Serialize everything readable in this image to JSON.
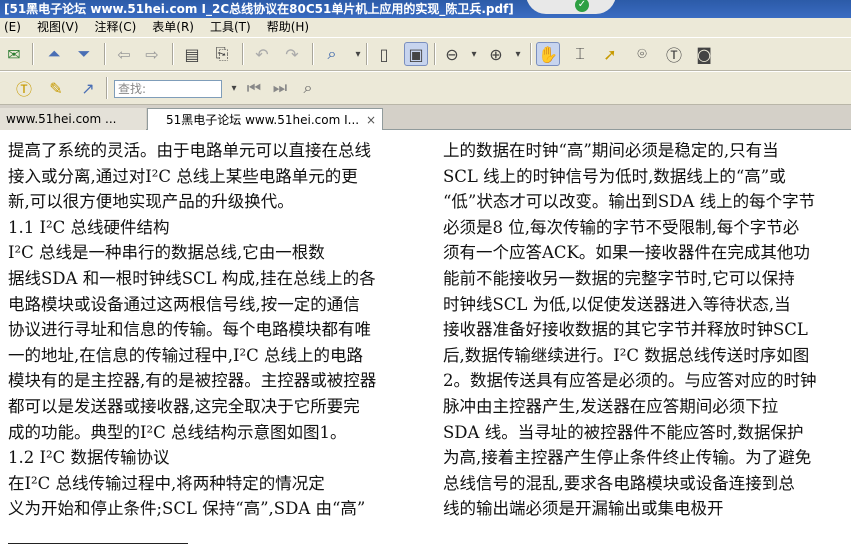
{
  "window": {
    "title": "[51黑电子论坛 www.51hei.com I_2C总线协议在80C51单片机上应用的实现_陈卫兵.pdf]"
  },
  "menu": [
    "(E)",
    "视图(V)",
    "注释(C)",
    "表单(R)",
    "工具(T)",
    "帮助(H)"
  ],
  "toolbar": {
    "find_placeholder": "查找:"
  },
  "tabs": [
    {
      "label": "www.51hei.com ..."
    },
    {
      "label": "51黑电子论坛 www.51hei.com I..."
    }
  ],
  "tab_close": "×",
  "document": {
    "left_lines": [
      "提高了系统的灵活。由于电路单元可以直接在总线",
      "接入或分离,通过对I²C 总线上某些电路单元的更",
      "新,可以很方便地实现产品的升级换代。",
      "1.1   I²C 总线硬件结构",
      "      I²C 总线是一种串行的数据总线,它由一根数",
      "据线SDA 和一根时钟线SCL 构成,挂在总线上的各",
      "电路模块或设备通过这两根信号线,按一定的通信",
      "协议进行寻址和信息的传输。每个电路模块都有唯",
      "一的地址,在信息的传输过程中,I²C 总线上的电路",
      "模块有的是主控器,有的是被控器。主控器或被控器",
      "都可以是发送器或接收器,这完全取决于它所要完",
      "成的功能。典型的I²C 总线结构示意图如图1。",
      "1.2   I²C 数据传输协议",
      "      在I²C 总线传输过程中,将两种特定的情况定",
      "义为开始和停止条件;SCL 保持“高”,SDA 由“高”"
    ],
    "right_lines": [
      "上的数据在时钟“高”期间必须是稳定的,只有当",
      "SCL 线上的时钟信号为低时,数据线上的“高”或",
      "“低”状态才可以改变。输出到SDA 线上的每个字节",
      "必须是8 位,每次传输的字节不受限制,每个字节必",
      "须有一个应答ACK。如果一接收器件在完成其他功",
      "能前不能接收另一数据的完整字节时,它可以保持",
      "时钟线SCL 为低,以促使发送器进入等待状态,当",
      "接收器准备好接收数据的其它字节并释放时钟SCL",
      "后,数据传输继续进行。I²C 数据总线传送时序如图",
      "2。数据传送具有应答是必须的。与应答对应的时钟",
      "脉冲由主控器产生,发送器在应答期间必须下拉",
      "SDA 线。当寻址的被控器件不能应答时,数据保护",
      "为高,接着主控器产生停止条件终止传输。为了避免",
      "总线信号的混乱,要求各电路模块或设备连接到总",
      "线的输出端必须是开漏输出或集电极开"
    ]
  }
}
